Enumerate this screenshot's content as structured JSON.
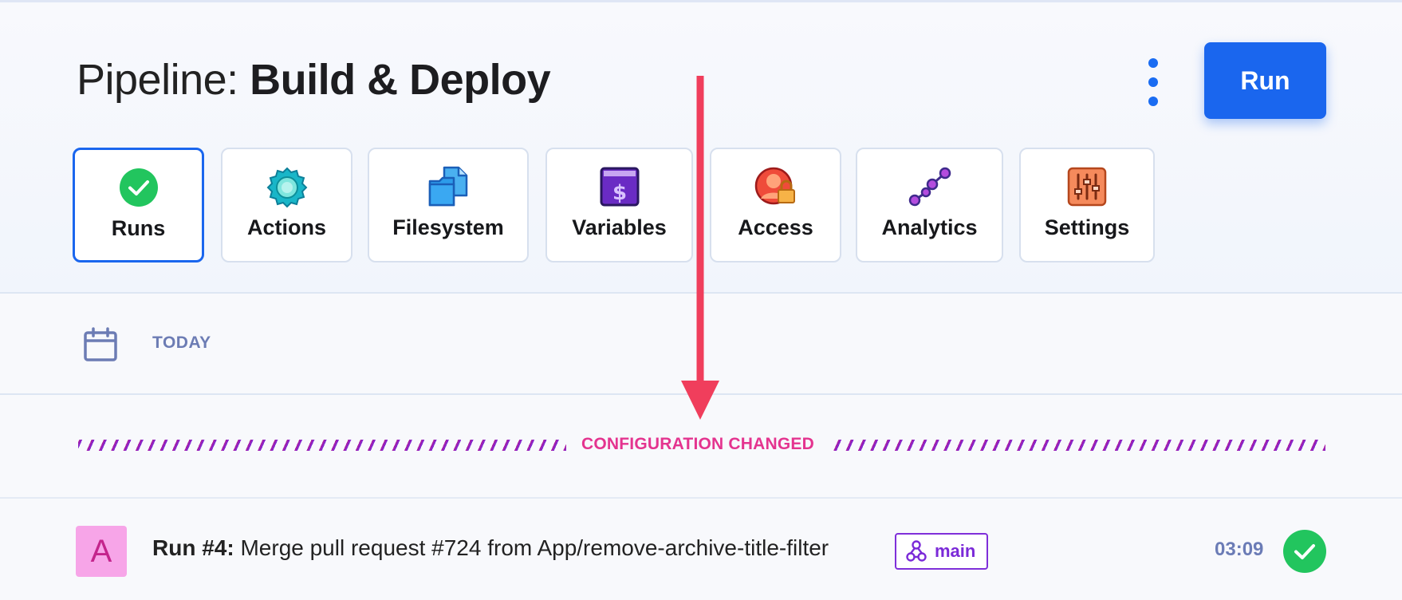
{
  "header": {
    "title_prefix": "Pipeline: ",
    "title_name": "Build & Deploy",
    "run_button_label": "Run",
    "more_menu_icon": "vertical-ellipsis-icon",
    "accent_color": "#1a66ee"
  },
  "tabs": [
    {
      "label": "Runs",
      "icon": "check-circle-icon",
      "active": true
    },
    {
      "label": "Actions",
      "icon": "gear-icon",
      "active": false
    },
    {
      "label": "Filesystem",
      "icon": "files-icon",
      "active": false
    },
    {
      "label": "Variables",
      "icon": "dollar-variable-icon",
      "active": false
    },
    {
      "label": "Access",
      "icon": "user-lock-icon",
      "active": false
    },
    {
      "label": "Analytics",
      "icon": "line-graph-icon",
      "active": false
    },
    {
      "label": "Settings",
      "icon": "sliders-icon",
      "active": false
    }
  ],
  "date_group": {
    "label": "TODAY",
    "icon": "calendar-icon"
  },
  "divider": {
    "label": "CONFIGURATION CHANGED",
    "color": "#e4348f"
  },
  "runs": [
    {
      "avatar_initial": "A",
      "run_number_label": "Run #4:",
      "message": " Merge pull request #724 from App/remove-archive-title-filter",
      "branch": "main",
      "duration": "03:09",
      "status": "success",
      "status_icon": "check-circle-icon"
    }
  ],
  "annotation": {
    "type": "arrow",
    "direction": "down",
    "color": "#f03e5c"
  }
}
